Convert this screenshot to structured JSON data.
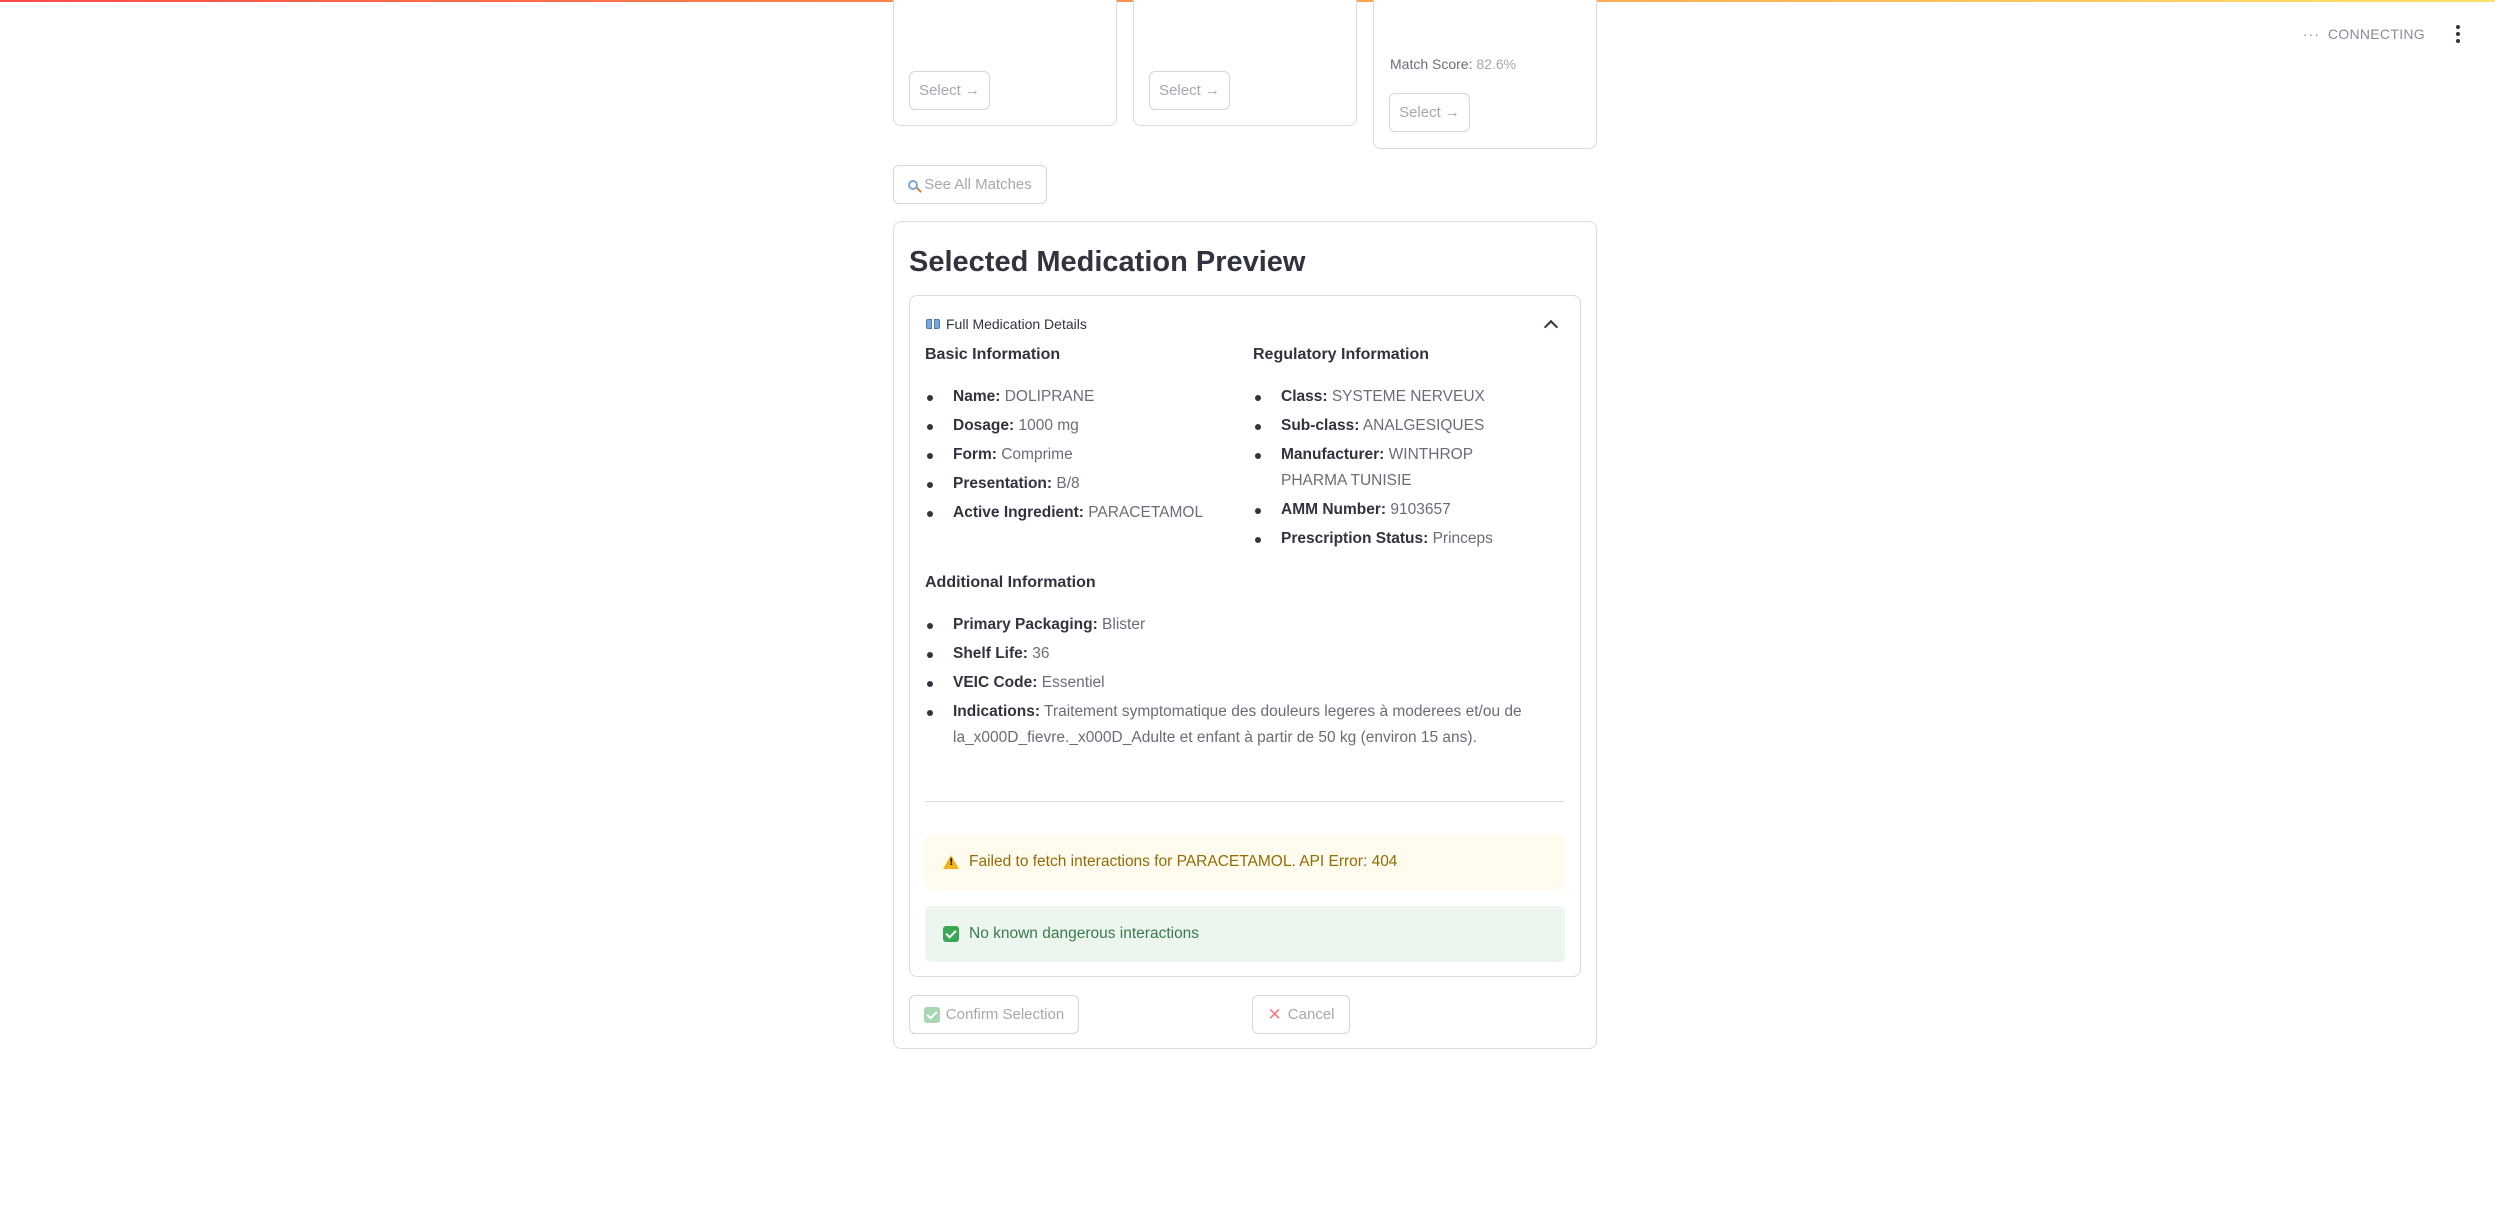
{
  "header": {
    "status_label": "CONNECTING",
    "status_dots": "···"
  },
  "match_cards": [
    {
      "select_label": "Select →"
    },
    {
      "select_label": "Select →"
    },
    {
      "match_score_label": "Match Score:",
      "match_score_value": "82.6%",
      "select_label": "Select →"
    }
  ],
  "see_all_matches_label": "See All Matches",
  "preview": {
    "title": "Selected Medication Preview",
    "expander_title": "Full Medication Details",
    "basic_title": "Basic Information",
    "basic": [
      {
        "label": "Name:",
        "value": "DOLIPRANE"
      },
      {
        "label": "Dosage:",
        "value": "1000 mg"
      },
      {
        "label": "Form:",
        "value": "Comprime"
      },
      {
        "label": "Presentation:",
        "value": "B/8"
      },
      {
        "label": "Active Ingredient:",
        "value": "PARACETAMOL"
      }
    ],
    "regulatory_title": "Regulatory Information",
    "regulatory": [
      {
        "label": "Class:",
        "value": "SYSTEME NERVEUX"
      },
      {
        "label": "Sub-class:",
        "value": "ANALGESIQUES"
      },
      {
        "label": "Manufacturer:",
        "value": "WINTHROP PHARMA TUNISIE"
      },
      {
        "label": "AMM Number:",
        "value": "9103657"
      },
      {
        "label": "Prescription Status:",
        "value": "Princeps"
      }
    ],
    "additional_title": "Additional Information",
    "additional": [
      {
        "label": "Primary Packaging:",
        "value": "Blister"
      },
      {
        "label": "Shelf Life:",
        "value": "36"
      },
      {
        "label": "VEIC Code:",
        "value": "Essentiel"
      },
      {
        "label": "Indications:",
        "value": "Traitement symptomatique des douleurs legeres à moderees et/ou de la_x000D_fievre._x000D_Adulte et enfant à partir de 50 kg (environ 15 ans)."
      }
    ],
    "warning_text": "Failed to fetch interactions for PARACETAMOL. API Error: 404",
    "success_text": "No known dangerous interactions",
    "confirm_label": "Confirm Selection",
    "cancel_label": "Cancel"
  }
}
